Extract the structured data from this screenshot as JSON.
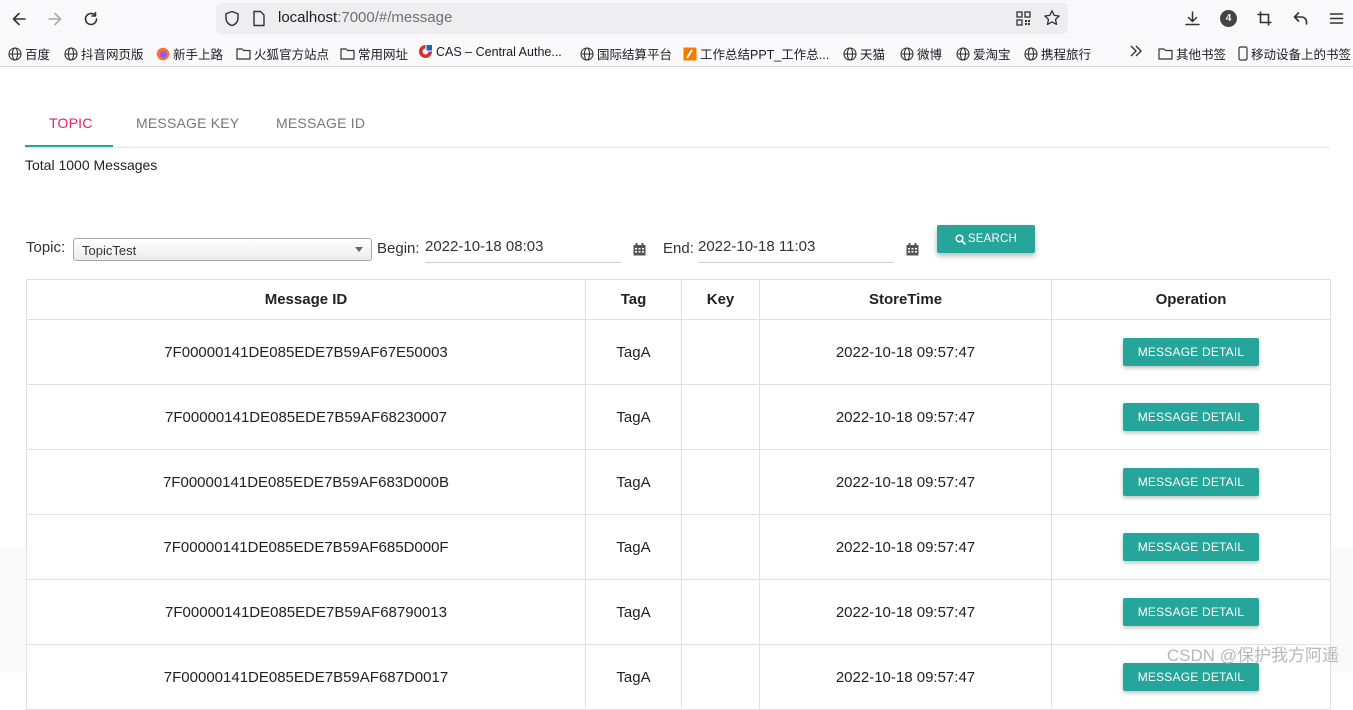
{
  "browser": {
    "url_host": "localhost",
    "url_rest": ":7000/#/message",
    "extension_badge": "4",
    "bookmarks": [
      {
        "label": "百度",
        "icon": "globe-icon"
      },
      {
        "label": "抖音网页版",
        "icon": "globe-icon"
      },
      {
        "label": "新手上路",
        "icon": "firefox-icon"
      },
      {
        "label": "火狐官方站点",
        "icon": "folder-icon"
      },
      {
        "label": "常用网址",
        "icon": "folder-icon"
      },
      {
        "label": "CAS – Central Authe...",
        "icon": "cas-icon"
      },
      {
        "label": "国际结算平台",
        "icon": "globe-icon"
      },
      {
        "label": "工作总结PPT_工作总...",
        "icon": "ppt-icon"
      },
      {
        "label": "天猫",
        "icon": "globe-icon"
      },
      {
        "label": "微博",
        "icon": "globe-icon"
      },
      {
        "label": "爱淘宝",
        "icon": "globe-icon"
      },
      {
        "label": "携程旅行",
        "icon": "globe-icon"
      }
    ],
    "other_bookmarks": "其他书签",
    "mobile_bookmarks": "移动设备上的书签"
  },
  "tabs": [
    {
      "label": "TOPIC",
      "active": true
    },
    {
      "label": "MESSAGE KEY",
      "active": false
    },
    {
      "label": "MESSAGE ID",
      "active": false
    }
  ],
  "total_text": "Total 1000 Messages",
  "filters": {
    "topic_label": "Topic:",
    "topic_value": "TopicTest",
    "begin_label": "Begin:",
    "begin_value": "2022-10-18 08:03",
    "end_label": "End:",
    "end_value": "2022-10-18 11:03",
    "search_label": "SEARCH"
  },
  "table": {
    "headers": [
      "Message ID",
      "Tag",
      "Key",
      "StoreTime",
      "Operation"
    ],
    "detail_label": "MESSAGE DETAIL",
    "rows": [
      {
        "id": "7F00000141DE085EDE7B59AF67E50003",
        "tag": "TagA",
        "key": "",
        "time": "2022-10-18 09:57:47"
      },
      {
        "id": "7F00000141DE085EDE7B59AF68230007",
        "tag": "TagA",
        "key": "",
        "time": "2022-10-18 09:57:47"
      },
      {
        "id": "7F00000141DE085EDE7B59AF683D000B",
        "tag": "TagA",
        "key": "",
        "time": "2022-10-18 09:57:47"
      },
      {
        "id": "7F00000141DE085EDE7B59AF685D000F",
        "tag": "TagA",
        "key": "",
        "time": "2022-10-18 09:57:47"
      },
      {
        "id": "7F00000141DE085EDE7B59AF68790013",
        "tag": "TagA",
        "key": "",
        "time": "2022-10-18 09:57:47"
      },
      {
        "id": "7F00000141DE085EDE7B59AF687D0017",
        "tag": "TagA",
        "key": "",
        "time": "2022-10-18 09:57:47"
      }
    ]
  },
  "watermark": "CSDN @保护我方阿遥",
  "colors": {
    "accent": "#26a69a",
    "active_tab": "#e91e63"
  }
}
